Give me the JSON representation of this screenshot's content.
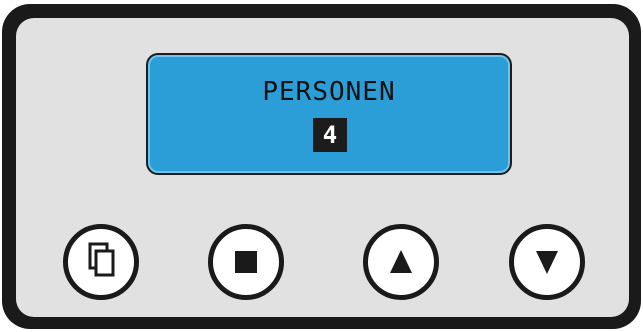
{
  "display": {
    "title": "PERSONEN",
    "value": "4"
  },
  "buttons": [
    {
      "name": "copy-button",
      "icon": "copy-icon"
    },
    {
      "name": "stop-button",
      "icon": "stop-icon"
    },
    {
      "name": "up-button",
      "icon": "arrow-up-icon"
    },
    {
      "name": "down-button",
      "icon": "arrow-down-icon"
    }
  ],
  "colors": {
    "lcd_background": "#2b9ed8",
    "panel_frame": "#1a1a1a",
    "panel_face": "#e1e1e1",
    "button_face": "#ffffff"
  }
}
